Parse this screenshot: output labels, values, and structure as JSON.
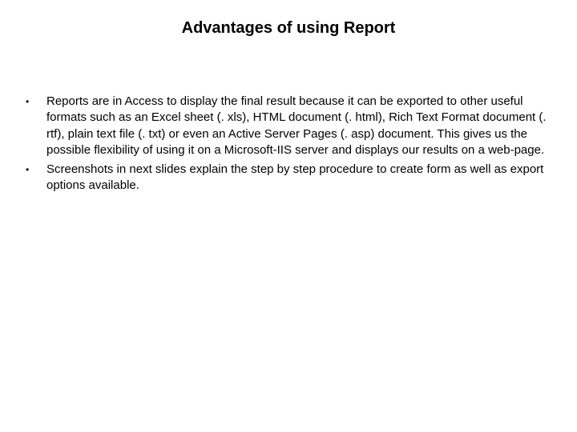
{
  "title": "Advantages of using Report",
  "bullets": [
    "Reports are in Access to display the final result because it can be exported to other useful formats such as an Excel sheet (. xls), HTML document (. html), Rich Text Format document (. rtf), plain text file (. txt) or even an Active Server Pages (. asp) document. This gives us the possible flexibility of using it on a Microsoft-IIS server and displays our results on a web-page.",
    "Screenshots in next slides explain the step by step procedure to create form as well as export options available."
  ]
}
